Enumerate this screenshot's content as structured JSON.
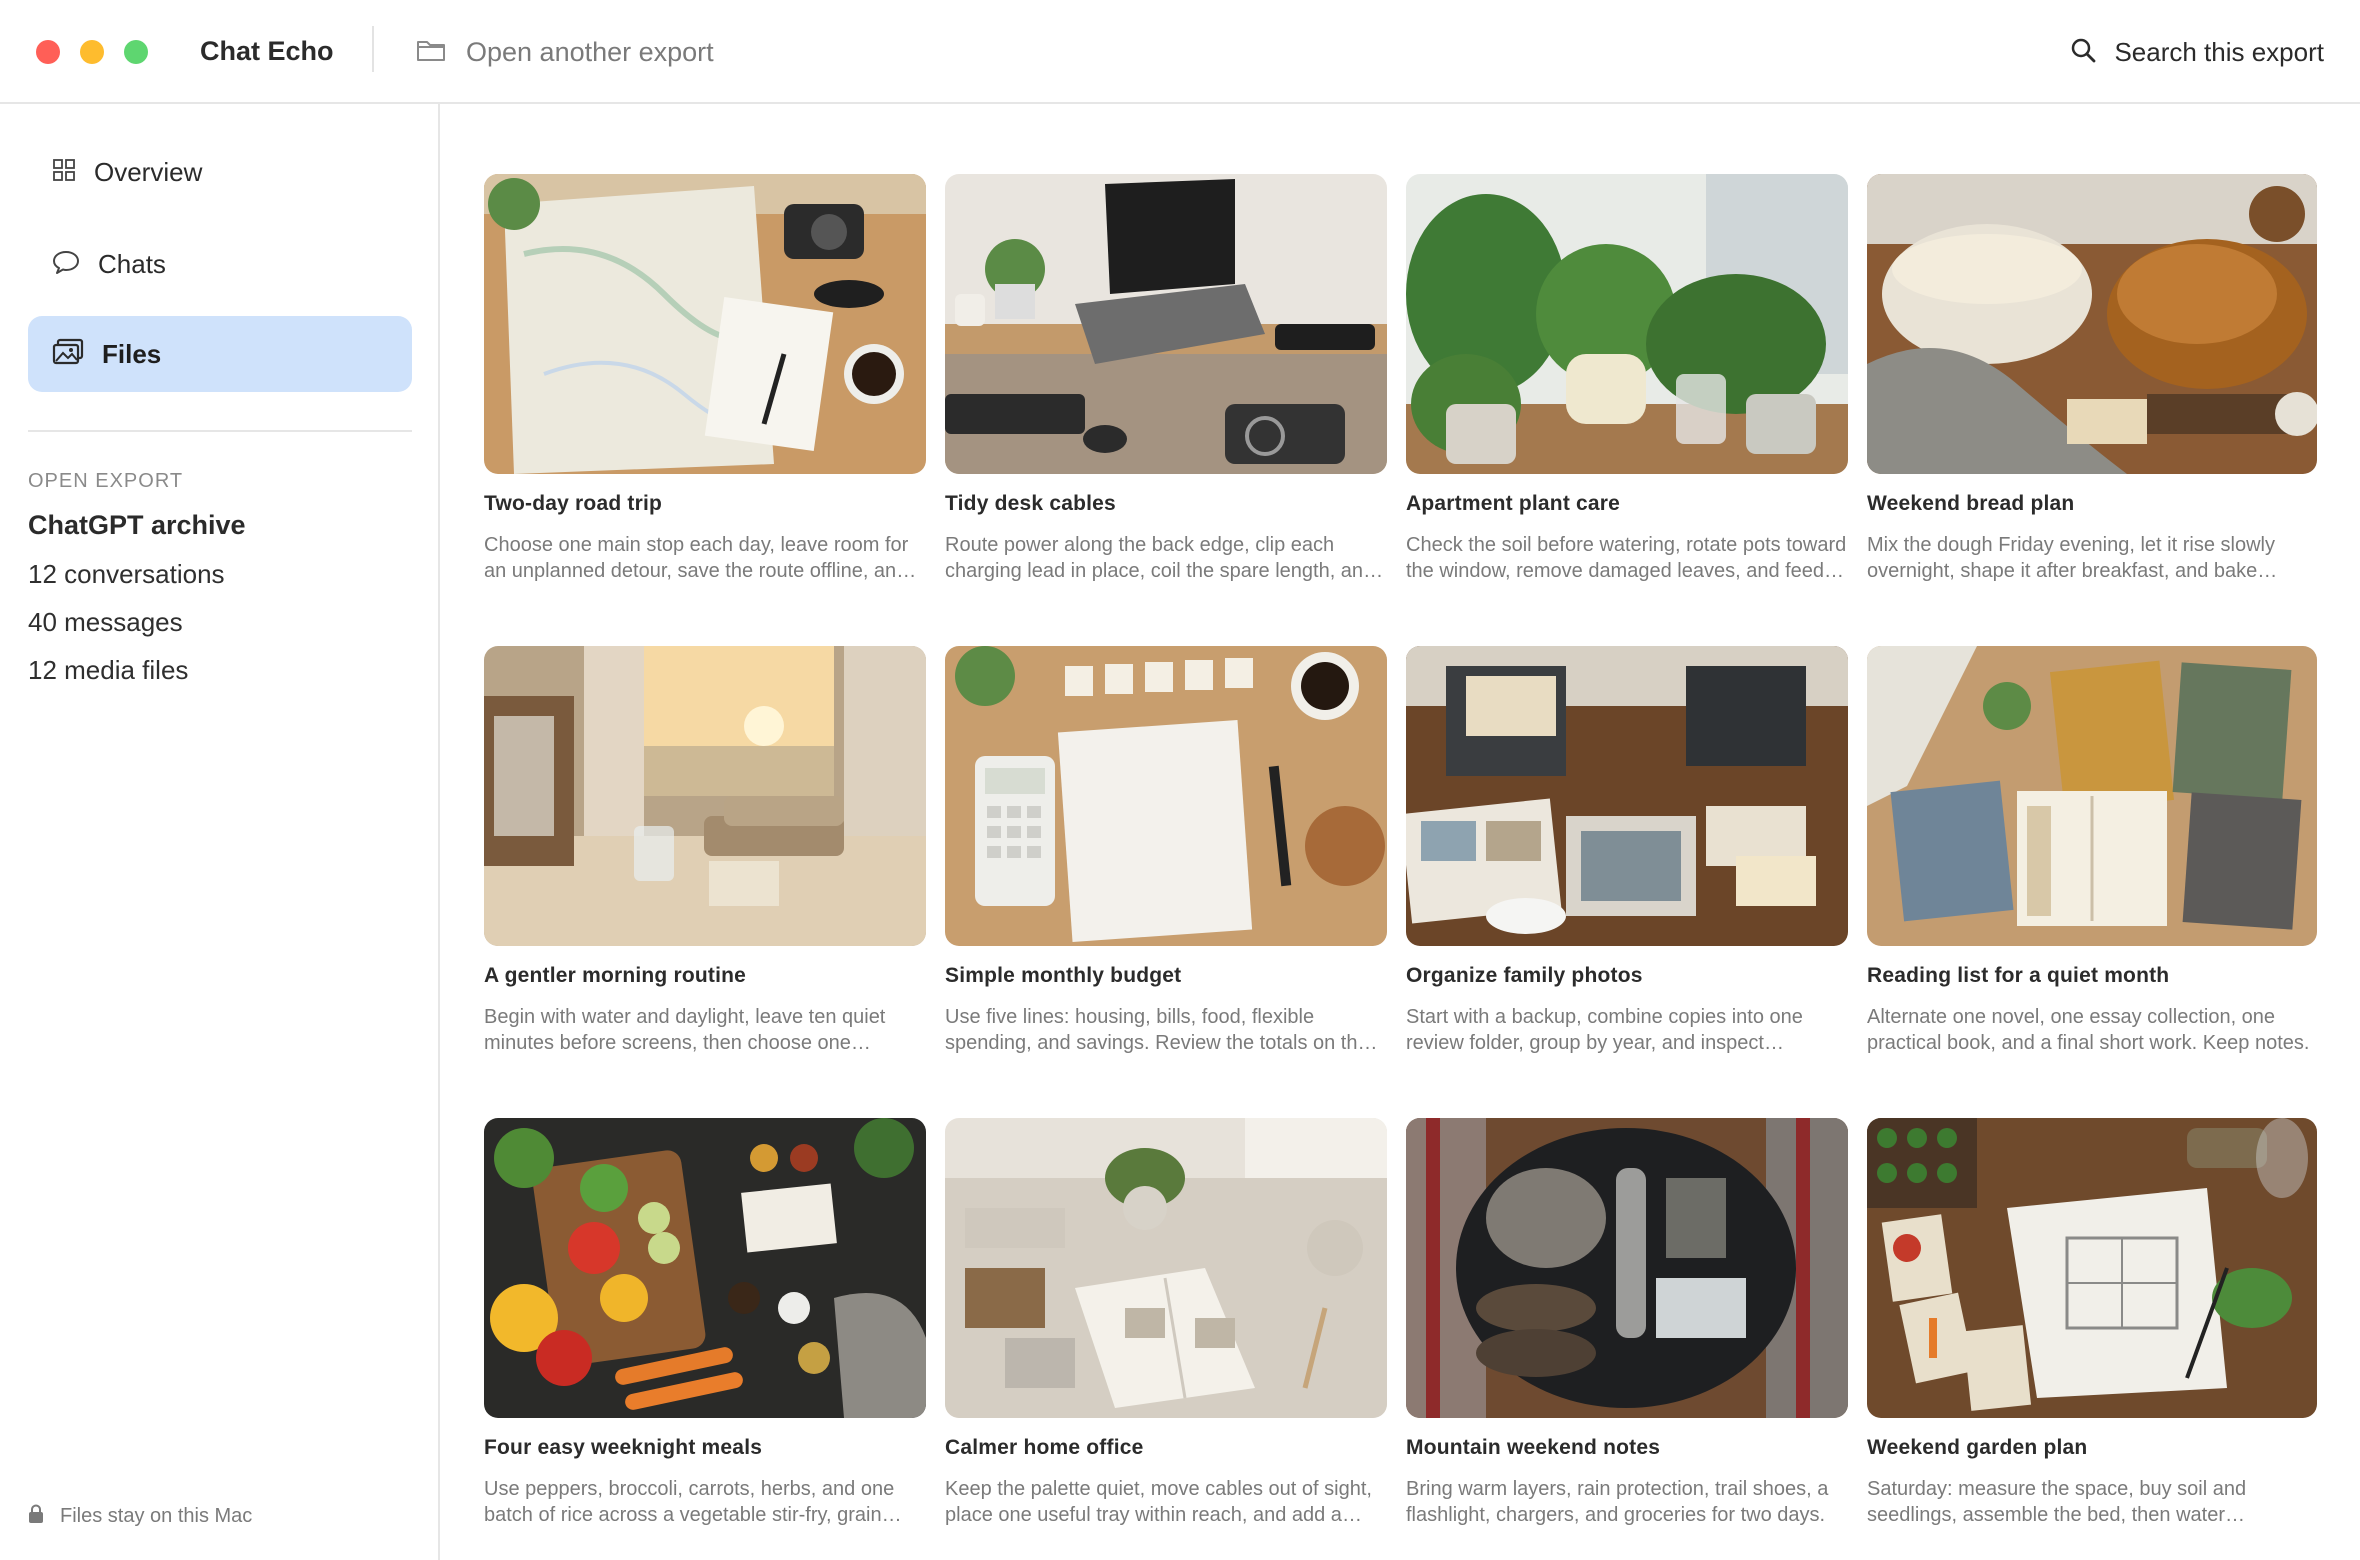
{
  "window": {
    "app_title": "Chat Echo",
    "open_another_label": "Open another export",
    "search_label": "Search this export"
  },
  "sidebar": {
    "items": [
      {
        "label": "Overview",
        "icon": "grid-icon"
      },
      {
        "label": "Chats",
        "icon": "chat-bubble-icon"
      },
      {
        "label": "Files",
        "icon": "photo-stack-icon",
        "active": true
      }
    ],
    "section_heading": "OPEN EXPORT",
    "archive_name": "ChatGPT archive",
    "stats": [
      "12 conversations",
      "40 messages",
      "12 media files"
    ],
    "footer": "Files stay on this Mac"
  },
  "files": [
    {
      "title": "Two-day road trip",
      "desc": "Choose one main stop each day, leave room for an unplanned detour, save the route offline, and pack snacks for the drive.",
      "thumb": "map-icon"
    },
    {
      "title": "Tidy desk cables",
      "desc": "Route power along the back edge, clip each charging lead in place, coil the spare length, and label the plugs.",
      "thumb": "laptop-icon"
    },
    {
      "title": "Apartment plant care",
      "desc": "Check the soil before watering, rotate pots toward the window, remove damaged leaves, and feed monthly.",
      "thumb": "plant-icon"
    },
    {
      "title": "Weekend bread plan",
      "desc": "Mix the dough Friday evening, let it rise slowly overnight, shape it after breakfast, and bake before lunch.",
      "thumb": "bread-icon"
    },
    {
      "title": "A gentler morning routine",
      "desc": "Begin with water and daylight, leave ten quiet minutes before screens, then choose one important task.",
      "thumb": "window-icon"
    },
    {
      "title": "Simple monthly budget",
      "desc": "Use five lines: housing, bills, food, flexible spending, and savings. Review the totals on the first of the month.",
      "thumb": "calculator-icon"
    },
    {
      "title": "Organize family photos",
      "desc": "Start with a backup, combine copies into one review folder, group by year, and inspect duplicates.",
      "thumb": "photo-box-icon"
    },
    {
      "title": "Reading list for a quiet month",
      "desc": "Alternate one novel, one essay collection, one practical book, and a final short work. Keep notes.",
      "thumb": "book-icon"
    },
    {
      "title": "Four easy weeknight meals",
      "desc": "Use peppers, broccoli, carrots, herbs, and one batch of rice across a vegetable stir-fry, grain bowls, and soup.",
      "thumb": "vegetables-icon"
    },
    {
      "title": "Calmer home office",
      "desc": "Keep the palette quiet, move cables out of sight, place one useful tray within reach, and add a plant.",
      "thumb": "office-icon"
    },
    {
      "title": "Mountain weekend notes",
      "desc": "Bring warm layers, rain protection, trail shoes, a flashlight, chargers, and groceries for two days.",
      "thumb": "backpack-icon"
    },
    {
      "title": "Weekend garden plan",
      "desc": "Saturday: measure the space, buy soil and seedlings, assemble the bed, then water everything well.",
      "thumb": "garden-icon"
    }
  ],
  "colors": {
    "accent_active_bg": "#cfe2fb",
    "traffic_red": "#ff5f57",
    "traffic_yellow": "#febc2e",
    "traffic_green": "#28c840"
  }
}
